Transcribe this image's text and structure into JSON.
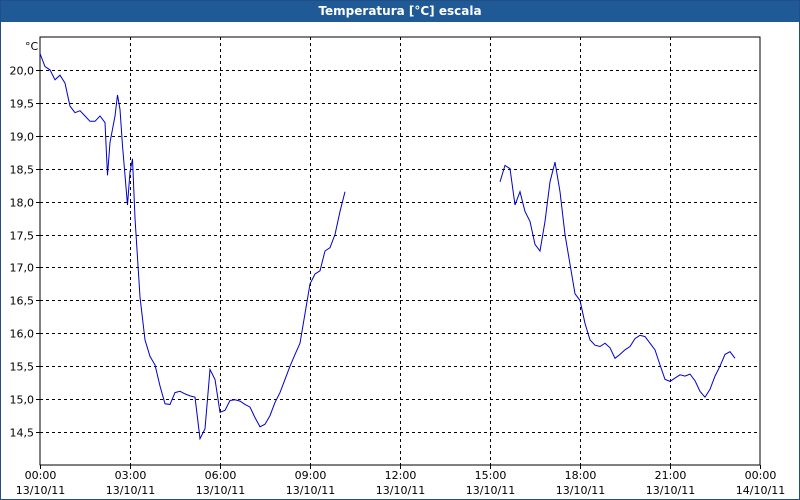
{
  "window": {
    "title": "Temperatura [°C] escala"
  },
  "chart_data": {
    "type": "line",
    "ylabel": "°C",
    "ylim": [
      14.0,
      20.5
    ],
    "xlim": [
      "13/10/11 00:00",
      "14/10/11 00:00"
    ],
    "grid": true,
    "y_ticks": [
      "14,5",
      "15,0",
      "15,5",
      "16,0",
      "16,5",
      "17,0",
      "17,5",
      "18,0",
      "18,5",
      "19,0",
      "19,5",
      "20,0"
    ],
    "x_ticks": [
      {
        "time": "00:00",
        "date": "13/10/11"
      },
      {
        "time": "03:00",
        "date": "13/10/11"
      },
      {
        "time": "06:00",
        "date": "13/10/11"
      },
      {
        "time": "09:00",
        "date": "13/10/11"
      },
      {
        "time": "12:00",
        "date": "13/10/11"
      },
      {
        "time": "15:00",
        "date": "13/10/11"
      },
      {
        "time": "18:00",
        "date": "13/10/11"
      },
      {
        "time": "21:00",
        "date": "13/10/11"
      },
      {
        "time": "00:00",
        "date": "14/10/11"
      }
    ],
    "series_color": "#0000cc",
    "segments": [
      [
        [
          "00:00",
          20.25
        ],
        [
          "00:10",
          20.05
        ],
        [
          "00:20",
          20.0
        ],
        [
          "00:30",
          19.85
        ],
        [
          "00:40",
          19.92
        ],
        [
          "00:50",
          19.8
        ],
        [
          "01:00",
          19.45
        ],
        [
          "01:10",
          19.35
        ],
        [
          "01:20",
          19.38
        ],
        [
          "01:30",
          19.3
        ],
        [
          "01:40",
          19.22
        ],
        [
          "01:50",
          19.22
        ],
        [
          "02:00",
          19.3
        ],
        [
          "02:10",
          19.2
        ],
        [
          "02:15",
          18.4
        ],
        [
          "02:20",
          18.9
        ],
        [
          "02:30",
          19.3
        ],
        [
          "02:35",
          19.62
        ],
        [
          "02:40",
          19.4
        ],
        [
          "02:45",
          18.85
        ],
        [
          "02:50",
          18.4
        ],
        [
          "02:55",
          17.95
        ],
        [
          "03:00",
          18.45
        ],
        [
          "03:05",
          18.65
        ],
        [
          "03:10",
          17.75
        ],
        [
          "03:20",
          16.55
        ],
        [
          "03:30",
          15.9
        ],
        [
          "03:40",
          15.65
        ],
        [
          "03:50",
          15.52
        ],
        [
          "04:00",
          15.2
        ],
        [
          "04:10",
          14.93
        ],
        [
          "04:20",
          14.92
        ],
        [
          "04:30",
          15.1
        ],
        [
          "04:40",
          15.12
        ],
        [
          "04:50",
          15.08
        ],
        [
          "05:00",
          15.05
        ],
        [
          "05:10",
          15.03
        ],
        [
          "05:20",
          14.4
        ],
        [
          "05:30",
          14.55
        ],
        [
          "05:40",
          15.45
        ],
        [
          "05:50",
          15.3
        ],
        [
          "06:00",
          14.8
        ],
        [
          "06:10",
          14.83
        ],
        [
          "06:20",
          14.98
        ],
        [
          "06:30",
          14.99
        ],
        [
          "06:40",
          14.97
        ],
        [
          "06:50",
          14.92
        ],
        [
          "07:00",
          14.88
        ],
        [
          "07:10",
          14.72
        ],
        [
          "07:20",
          14.58
        ],
        [
          "07:30",
          14.62
        ],
        [
          "07:40",
          14.75
        ],
        [
          "07:50",
          14.95
        ],
        [
          "08:00",
          15.1
        ],
        [
          "08:10",
          15.3
        ],
        [
          "08:20",
          15.5
        ],
        [
          "08:30",
          15.68
        ],
        [
          "08:40",
          15.85
        ],
        [
          "08:50",
          16.3
        ],
        [
          "09:00",
          16.75
        ],
        [
          "09:10",
          16.9
        ],
        [
          "09:20",
          16.95
        ],
        [
          "09:30",
          17.25
        ],
        [
          "09:40",
          17.3
        ],
        [
          "09:50",
          17.5
        ],
        [
          "10:00",
          17.85
        ],
        [
          "10:10",
          18.15
        ]
      ],
      [
        [
          "15:20",
          18.3
        ],
        [
          "15:30",
          18.55
        ],
        [
          "15:40",
          18.5
        ],
        [
          "15:50",
          17.95
        ],
        [
          "16:00",
          18.15
        ],
        [
          "16:10",
          17.85
        ],
        [
          "16:20",
          17.7
        ],
        [
          "16:30",
          17.35
        ],
        [
          "16:40",
          17.25
        ],
        [
          "16:50",
          17.7
        ],
        [
          "17:00",
          18.3
        ],
        [
          "17:10",
          18.6
        ],
        [
          "17:20",
          18.15
        ],
        [
          "17:30",
          17.5
        ],
        [
          "17:40",
          17.05
        ],
        [
          "17:50",
          16.6
        ],
        [
          "18:00",
          16.5
        ],
        [
          "18:10",
          16.15
        ],
        [
          "18:20",
          15.9
        ],
        [
          "18:30",
          15.82
        ],
        [
          "18:40",
          15.8
        ],
        [
          "18:50",
          15.85
        ],
        [
          "19:00",
          15.78
        ],
        [
          "19:10",
          15.62
        ],
        [
          "19:20",
          15.68
        ],
        [
          "19:30",
          15.75
        ],
        [
          "19:40",
          15.8
        ],
        [
          "19:50",
          15.92
        ],
        [
          "20:00",
          15.97
        ],
        [
          "20:10",
          15.95
        ],
        [
          "20:20",
          15.85
        ],
        [
          "20:30",
          15.75
        ],
        [
          "20:40",
          15.52
        ],
        [
          "20:50",
          15.3
        ],
        [
          "21:00",
          15.27
        ],
        [
          "21:10",
          15.32
        ],
        [
          "21:20",
          15.37
        ],
        [
          "21:30",
          15.35
        ],
        [
          "21:40",
          15.38
        ],
        [
          "21:50",
          15.28
        ],
        [
          "22:00",
          15.12
        ],
        [
          "22:10",
          15.03
        ],
        [
          "22:20",
          15.15
        ],
        [
          "22:30",
          15.35
        ],
        [
          "22:40",
          15.5
        ],
        [
          "22:50",
          15.68
        ],
        [
          "23:00",
          15.72
        ],
        [
          "23:10",
          15.62
        ]
      ]
    ]
  }
}
